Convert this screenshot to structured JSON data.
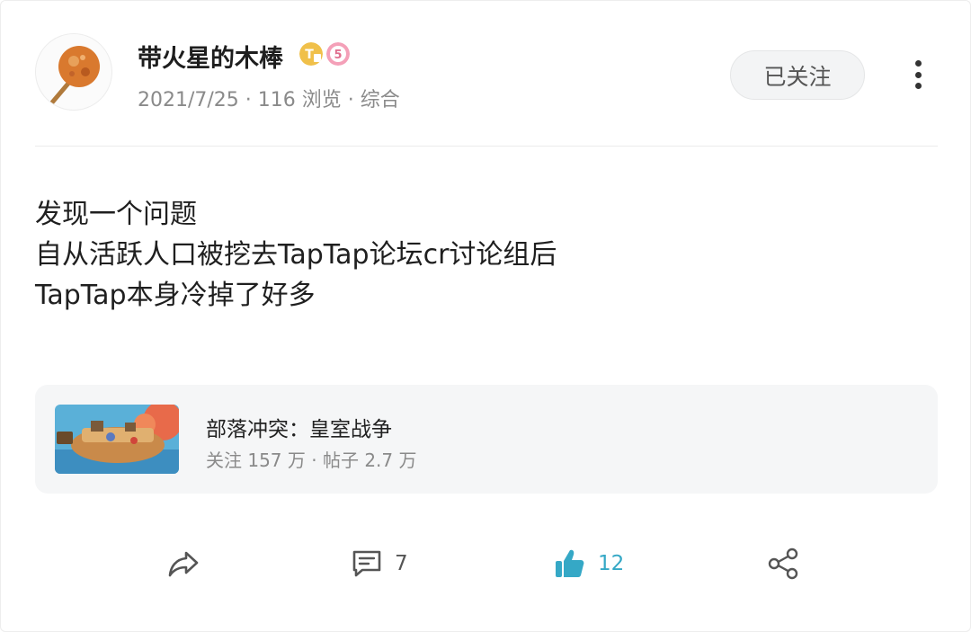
{
  "post": {
    "author": {
      "name": "带火星的木棒",
      "badge_t_label": "T",
      "badge_level_label": "5"
    },
    "meta": "2021/7/25 · 116 浏览 · 综合",
    "follow_label": "已关注",
    "content_lines": [
      "发现一个问题",
      "自从活跃人口被挖去TapTap论坛cr讨论组后",
      "TapTap本身冷掉了好多"
    ]
  },
  "game": {
    "name": "部落冲突：皇室战争",
    "stats": "关注 157 万 · 帖子 2.7 万"
  },
  "actions": {
    "comment_count": "7",
    "like_count": "12"
  },
  "colors": {
    "accent": "#35a8c6",
    "badge_gold": "#f0c04a",
    "badge_pink": "#f4a0b8"
  }
}
